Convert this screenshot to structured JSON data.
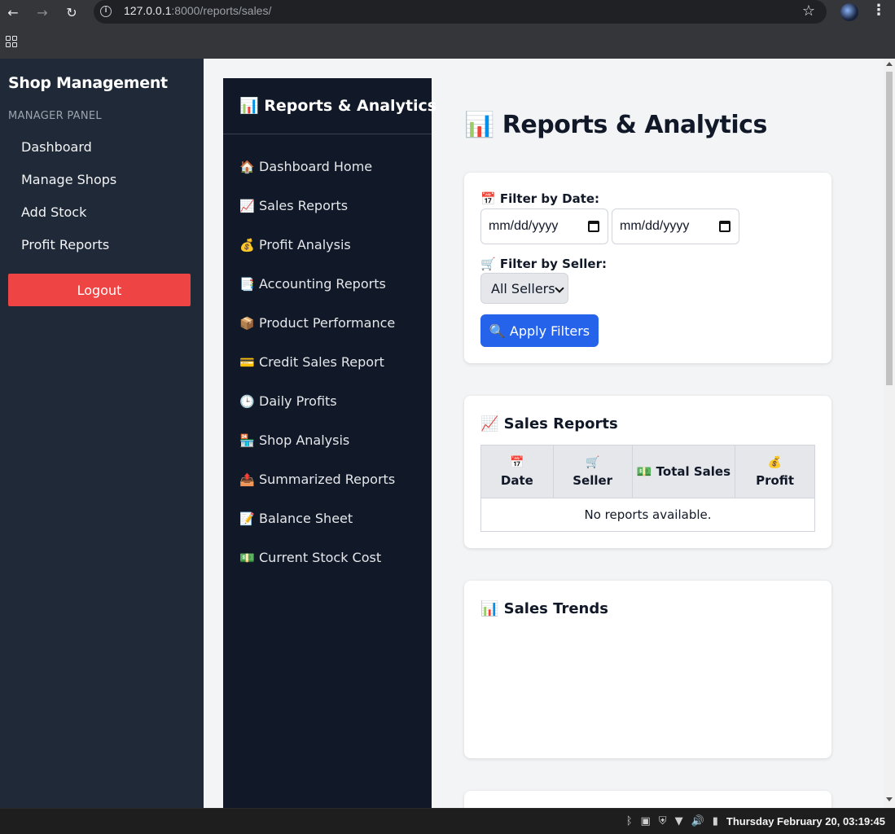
{
  "browser": {
    "back_icon": "←",
    "forward_icon": "→",
    "reload_icon": "↻",
    "url_host": "127.0.0.1",
    "url_rest": ":8000/reports/sales/",
    "star_icon": "☆",
    "menu_icon": "⋮"
  },
  "app_sidebar": {
    "brand": "Shop Management",
    "panel_label": "MANAGER PANEL",
    "items": [
      {
        "label": "Dashboard"
      },
      {
        "label": "Manage Shops"
      },
      {
        "label": "Add Stock"
      },
      {
        "label": "Profit Reports"
      }
    ],
    "logout_label": "Logout"
  },
  "reports_sidebar": {
    "title": "📊 Reports & Analytics",
    "items": [
      {
        "icon": "🏠",
        "label": "Dashboard Home"
      },
      {
        "icon": "📈",
        "label": "Sales Reports"
      },
      {
        "icon": "💰",
        "label": "Profit Analysis"
      },
      {
        "icon": "📑",
        "label": "Accounting Reports"
      },
      {
        "icon": "📦",
        "label": "Product Performance"
      },
      {
        "icon": "💳",
        "label": "Credit Sales Report"
      },
      {
        "icon": "🕒",
        "label": "Daily Profits"
      },
      {
        "icon": "🏪",
        "label": "Shop Analysis"
      },
      {
        "icon": "📤",
        "label": "Summarized Reports"
      },
      {
        "icon": "📝",
        "label": "Balance Sheet"
      },
      {
        "icon": "💵",
        "label": "Current Stock Cost"
      }
    ]
  },
  "main": {
    "title": "📊 Reports & Analytics",
    "filter": {
      "date_label": "📅 Filter by Date:",
      "start_date_placeholder": "mm/dd/yyyy",
      "end_date_placeholder": "mm/dd/yyyy",
      "seller_label": "🛒 Filter by Seller:",
      "seller_selected": "All Sellers",
      "apply_label": "🔍 Apply Filters"
    },
    "sales_reports": {
      "heading": "📈 Sales Reports",
      "columns": [
        {
          "icon": "📅",
          "label": "Date"
        },
        {
          "icon": "🛒",
          "label": "Seller"
        },
        {
          "icon": "💵",
          "label": "Total Sales"
        },
        {
          "icon": "💰",
          "label": "Profit"
        }
      ],
      "empty_message": "No reports available."
    },
    "sales_trends": {
      "heading": "📊 Sales Trends"
    }
  },
  "taskbar": {
    "clock": "Thursday February 20, 03:19:45"
  }
}
